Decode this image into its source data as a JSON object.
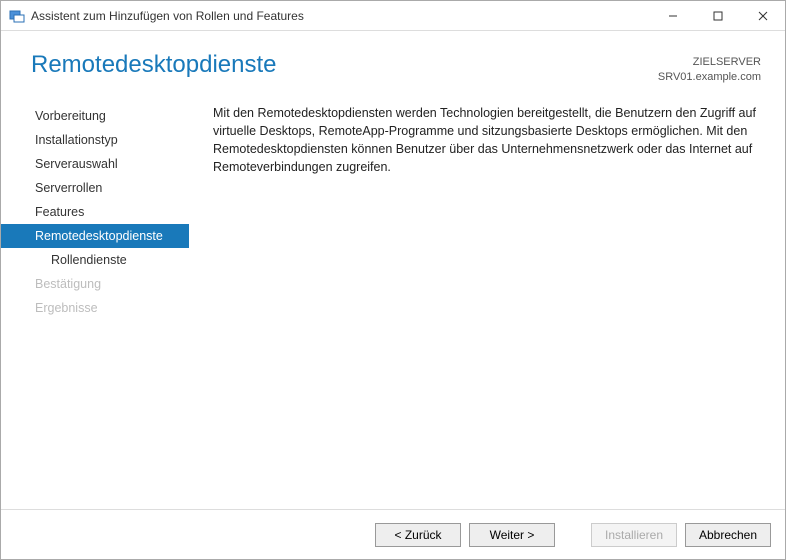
{
  "titlebar": {
    "title": "Assistent zum Hinzufügen von Rollen und Features"
  },
  "header": {
    "page_title": "Remotedesktopdienste",
    "target_label": "ZIELSERVER",
    "target_value": "SRV01.example.com"
  },
  "sidebar": {
    "items": [
      {
        "label": "Vorbereitung",
        "state": "normal",
        "indent": false
      },
      {
        "label": "Installationstyp",
        "state": "normal",
        "indent": false
      },
      {
        "label": "Serverauswahl",
        "state": "normal",
        "indent": false
      },
      {
        "label": "Serverrollen",
        "state": "normal",
        "indent": false
      },
      {
        "label": "Features",
        "state": "normal",
        "indent": false
      },
      {
        "label": "Remotedesktopdienste",
        "state": "selected",
        "indent": false
      },
      {
        "label": "Rollendienste",
        "state": "normal",
        "indent": true
      },
      {
        "label": "Bestätigung",
        "state": "disabled",
        "indent": false
      },
      {
        "label": "Ergebnisse",
        "state": "disabled",
        "indent": false
      }
    ]
  },
  "content": {
    "description": "Mit den Remotedesktopdiensten werden Technologien bereitgestellt, die Benutzern den Zugriff auf virtuelle Desktops, RemoteApp-Programme und sitzungsbasierte Desktops ermöglichen. Mit den Remotedesktopdiensten können Benutzer über das Unternehmensnetzwerk oder das Internet auf Remoteverbindungen zugreifen."
  },
  "footer": {
    "back": "< Zurück",
    "next": "Weiter >",
    "install": "Installieren",
    "cancel": "Abbrechen"
  }
}
